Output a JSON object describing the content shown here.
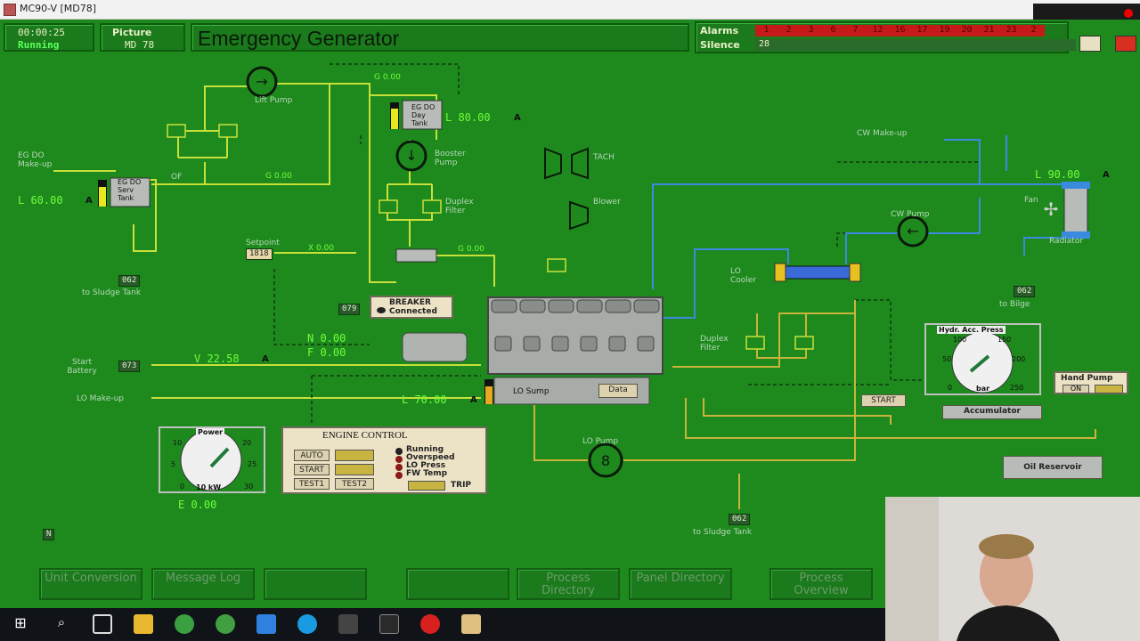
{
  "window": {
    "title": "MC90-V [MD78]"
  },
  "header": {
    "time": "00:00:25",
    "status": "Running",
    "picture_label": "Picture",
    "picture_value": "MD 78",
    "page_title": "Emergency Generator",
    "alarms_label": "Alarms",
    "silence_label": "Silence",
    "silence_value": "28",
    "alarm_numbers": [
      "1",
      "2",
      "3",
      "6",
      "7",
      "12",
      "16",
      "17",
      "19",
      "20",
      "21",
      "23",
      "2"
    ]
  },
  "diagram": {
    "lift_pump": "Lift Pump",
    "eg_do_makeup": "EG DO Make-up",
    "eg_do_serv_tank": "EG DO Serv Tank",
    "level_serv": "L  60.00",
    "serv_a": "A",
    "of_label": "OF",
    "g_top": "G 0.00",
    "g_mid": "G 0.00",
    "day_tank": "EG DO Day Tank",
    "level_day": "L  80.00",
    "day_a": "A",
    "booster_pump": "Booster Pump",
    "duplex_filter_1": "Duplex Filter",
    "tach": "TACH",
    "blower": "Blower",
    "cw_makeup": "CW Make-up",
    "level_cw": "L  90.00",
    "cw_a": "A",
    "fan": "Fan",
    "radiator": "Radiator",
    "cw_pump": "CW Pump",
    "to_bilge": "to Bilge",
    "tag_bilge": "062",
    "lo_cooler": "LO Cooler",
    "duplex_filter_2": "Duplex Filter",
    "setpoint": "Setpoint",
    "setpoint_val": "1818",
    "x_val": "X 0.00",
    "g_gov": "G 0.00",
    "tag_sludge_1": "062",
    "to_sludge_1": "to Sludge Tank",
    "tag_079": "079",
    "breaker_title": "BREAKER",
    "breaker_state": "Connected",
    "n_val": "N  0.00",
    "f_val": "F  0.00",
    "start_battery": "Start Battery",
    "tag_073": "073",
    "v_val": "V  22.58",
    "v_a": "A",
    "lo_makeup": "LO Make-up",
    "lo_sump": "LO Sump",
    "data_btn": "Data",
    "level_lo": "L  70.00",
    "lo_a": "A",
    "lo_pump": "LO Pump",
    "tag_sludge_2": "062",
    "to_sludge_2": "to Sludge Tank",
    "start_btn": "START",
    "hydr_title": "Hydr. Acc. Press",
    "hydr_unit": "bar",
    "hydr_ticks": [
      "0",
      "50",
      "100",
      "150",
      "200",
      "250"
    ],
    "accumulator": "Accumulator",
    "hand_pump": "Hand Pump",
    "hand_on": "ON",
    "oil_reservoir": "Oil Reservoir",
    "power_title": "Power",
    "power_unit": "10 kW",
    "power_ticks": [
      "0",
      "5",
      "10",
      "20",
      "25",
      "30"
    ],
    "e_val": "E  0.00",
    "n_box": "N"
  },
  "engine_control": {
    "title": "ENGINE CONTROL",
    "auto": "AUTO",
    "start": "START",
    "test1": "TEST1",
    "test2": "TEST2",
    "ind_running": "Running",
    "ind_overspeed": "Overspeed",
    "ind_lo_press": "LO Press",
    "ind_fw_temp": "FW Temp",
    "trip": "TRIP"
  },
  "nav": {
    "unit_conversion": "Unit Conversion",
    "message_log": "Message Log",
    "blank1": "",
    "blank2": "",
    "process_directory": "Process Directory",
    "panel_directory": "Panel Directory",
    "process_overview": "Process Overview"
  },
  "colors": {
    "background": "#1e8a1e",
    "pipe_fuel": "#c8e03a",
    "pipe_water": "#3a8ae0",
    "pipe_oil": "#c8b43a",
    "alarm": "#c61a1a"
  }
}
